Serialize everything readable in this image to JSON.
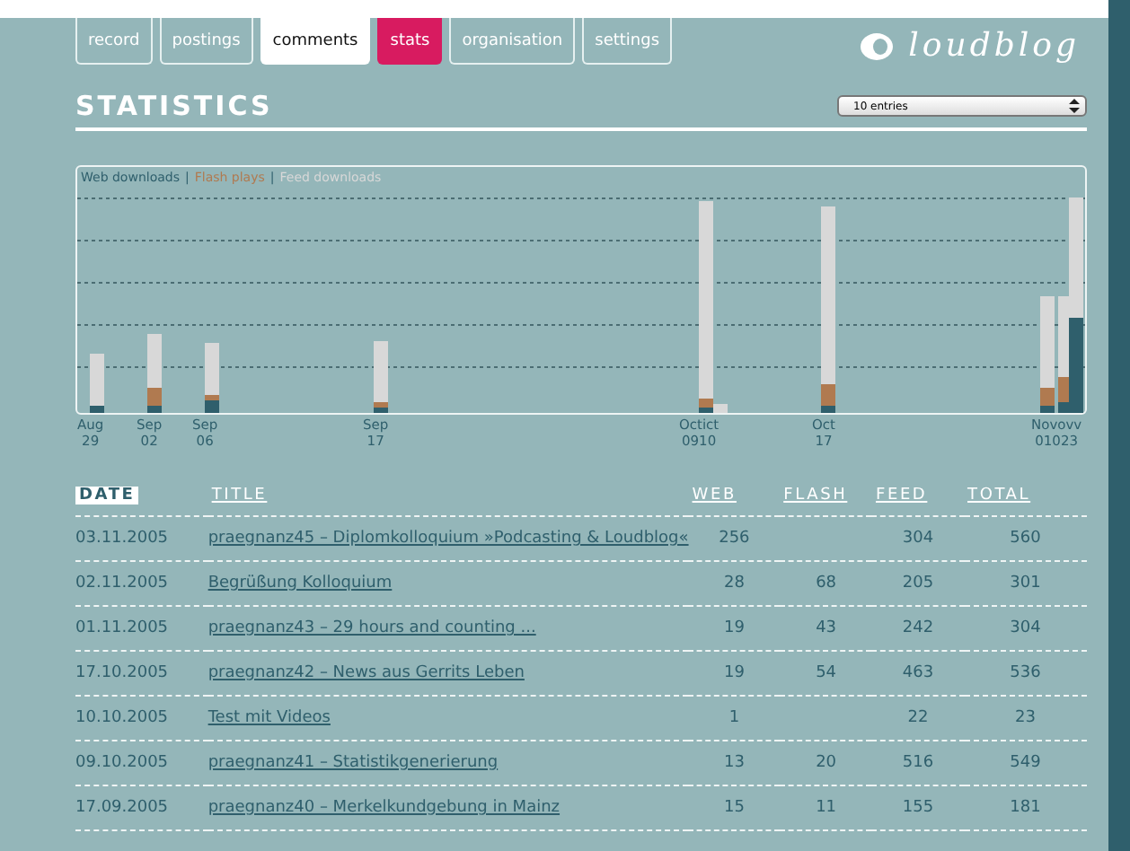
{
  "tabs": [
    {
      "label": "record",
      "selected": false,
      "kind": "plain"
    },
    {
      "label": "postings",
      "selected": false,
      "kind": "plain"
    },
    {
      "label": "comments",
      "selected": true,
      "kind": "plain"
    },
    {
      "label": "stats",
      "selected": false,
      "kind": "highlight"
    },
    {
      "label": "organisation",
      "selected": false,
      "kind": "plain"
    },
    {
      "label": "settings",
      "selected": false,
      "kind": "plain"
    }
  ],
  "logo": "loudblog",
  "heading": "STATISTICS",
  "entries_select": {
    "value": "10 entries"
  },
  "chart": {
    "legend": [
      {
        "kind": "label",
        "label": "Web downloads",
        "color": "#2f5f6c"
      },
      {
        "kind": "separator",
        "label": "|"
      },
      {
        "kind": "label",
        "label": "Flash plays",
        "color": "#b07a50"
      },
      {
        "kind": "separator",
        "label": "|"
      },
      {
        "kind": "label",
        "label": "Feed downloads",
        "color": "#d8d8d8"
      }
    ],
    "x_labels": [
      {
        "month": "Aug",
        "day": "29"
      },
      {
        "month": "Sep",
        "day": "02"
      },
      {
        "month": "Sep",
        "day": "06"
      },
      {
        "month": "Sep",
        "day": "17"
      },
      {
        "month": "Octict",
        "day": "0910"
      },
      {
        "month": "Oct",
        "day": "17"
      },
      {
        "month": "Novovv",
        "day": "01023"
      }
    ]
  },
  "table": {
    "columns": [
      {
        "label": "DATE",
        "selected": true
      },
      {
        "label": "TITLE",
        "selected": false
      },
      {
        "label": "WEB",
        "selected": false
      },
      {
        "label": "FLASH",
        "selected": false
      },
      {
        "label": "FEED",
        "selected": false
      },
      {
        "label": "TOTAL",
        "selected": false
      }
    ],
    "rows": [
      [
        "03.11.2005",
        "praegnanz45 – Diplomkolloquium »Podcasting & Loudblog«",
        "256",
        "",
        "304",
        "560"
      ],
      [
        "02.11.2005",
        "Begrüßung Kolloquium",
        "28",
        "68",
        "205",
        "301"
      ],
      [
        "01.11.2005",
        "praegnanz43 – 29 hours and counting ...",
        "19",
        "43",
        "242",
        "304"
      ],
      [
        "17.10.2005",
        "praegnanz42 – News aus Gerrits Leben",
        "19",
        "54",
        "463",
        "536"
      ],
      [
        "10.10.2005",
        "Test mit Videos",
        "1",
        "",
        "22",
        "23"
      ],
      [
        "09.10.2005",
        "praegnanz41 – Statistikgenerierung",
        "13",
        "20",
        "516",
        "549"
      ],
      [
        "17.09.2005",
        "praegnanz40 – Merkelkundgebung in Mainz",
        "15",
        "11",
        "155",
        "181"
      ]
    ]
  }
}
